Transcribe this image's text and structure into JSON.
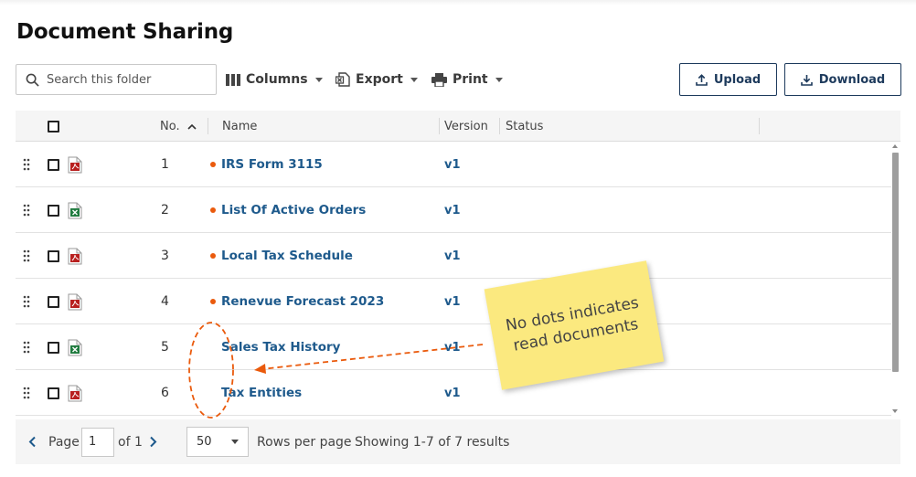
{
  "page": {
    "title": "Document Sharing"
  },
  "toolbar": {
    "search_placeholder": "Search this folder",
    "search_value": "",
    "columns_label": "Columns",
    "export_label": "Export",
    "print_label": "Print",
    "upload_label": "Upload",
    "download_label": "Download"
  },
  "grid": {
    "headers": {
      "number": "No.",
      "name": "Name",
      "version": "Version",
      "status": "Status"
    },
    "sort": {
      "column": "No.",
      "direction": "ascending"
    },
    "rows": [
      {
        "number": "1",
        "name": "IRS Form 3115",
        "version": "v1",
        "status": "",
        "file_type": "pdf-icon",
        "unread": true
      },
      {
        "number": "2",
        "name": "List Of Active Orders",
        "version": "v1",
        "status": "",
        "file_type": "excel-icon",
        "unread": true
      },
      {
        "number": "3",
        "name": "Local Tax Schedule",
        "version": "v1",
        "status": "",
        "file_type": "pdf-icon",
        "unread": true
      },
      {
        "number": "4",
        "name": "Renevue Forecast 2023",
        "version": "v1",
        "status": "",
        "file_type": "pdf-icon",
        "unread": true
      },
      {
        "number": "5",
        "name": "Sales Tax History",
        "version": "v1",
        "status": "",
        "file_type": "excel-icon",
        "unread": false
      },
      {
        "number": "6",
        "name": "Tax Entities",
        "version": "v1",
        "status": "",
        "file_type": "pdf-icon",
        "unread": false
      }
    ]
  },
  "pagination": {
    "page_label": "Page",
    "page_value": "1",
    "of_label": "of 1",
    "rows_per_page_value": "50",
    "rows_per_page_label": "Rows per page",
    "showing_text": "Showing 1-7 of 7 results"
  },
  "annotation": {
    "note_text": "No dots indicates read documents"
  },
  "colors": {
    "unread_dot": "#ea5a0c",
    "link": "#1e5a8c",
    "button_border": "#1d3a5c",
    "note": "#fbe97f",
    "pdf_icon": "#b8201f",
    "excel_icon": "#1f7a3e"
  }
}
